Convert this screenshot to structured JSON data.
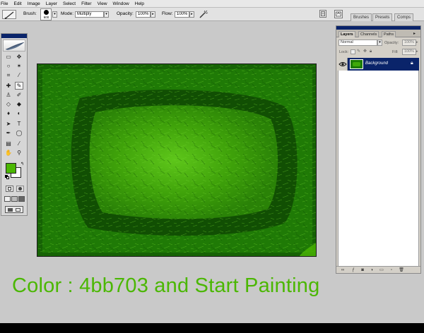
{
  "menubar": {
    "items": [
      "File",
      "Edit",
      "Image",
      "Layer",
      "Select",
      "Filter",
      "View",
      "Window",
      "Help"
    ]
  },
  "options_bar": {
    "brush_label": "Brush:",
    "brush_size": "600",
    "mode_label": "Mode:",
    "mode_value": "Multiply",
    "opacity_label": "Opacity:",
    "opacity_value": "100%",
    "flow_label": "Flow:",
    "flow_value": "100%",
    "well_tabs": [
      "Brushes",
      "Presets",
      "Comps"
    ]
  },
  "toolbox": {
    "foreground_color": "#4bb703",
    "background_color": "#ffffff",
    "tools": [
      "marquee-icon",
      "move-icon",
      "lasso-icon",
      "magic-wand-icon",
      "crop-icon",
      "slice-icon",
      "healing-icon",
      "brush-icon",
      "stamp-icon",
      "history-brush-icon",
      "eraser-icon",
      "bucket-icon",
      "blur-icon",
      "dodge-icon",
      "path-select-icon",
      "type-icon",
      "pen-icon",
      "shape-icon",
      "notes-icon",
      "eyedropper-icon",
      "hand-icon",
      "zoom-icon"
    ]
  },
  "layers_panel": {
    "tabs": [
      "Layers",
      "Channels",
      "Paths"
    ],
    "blend_mode": "Normal",
    "opacity_label": "Opacity:",
    "opacity_value": "100%",
    "lock_label": "Lock:",
    "fill_label": "Fill:",
    "fill_value": "100%",
    "layers": [
      {
        "name": "Background",
        "visible": true,
        "locked": true,
        "selected": true
      }
    ]
  },
  "caption": "Color : 4bb703 and Start Painting",
  "colors": {
    "paint_green": "#4bb703",
    "dark_green": "#0f4a03",
    "selection_blue": "#0a246a"
  }
}
